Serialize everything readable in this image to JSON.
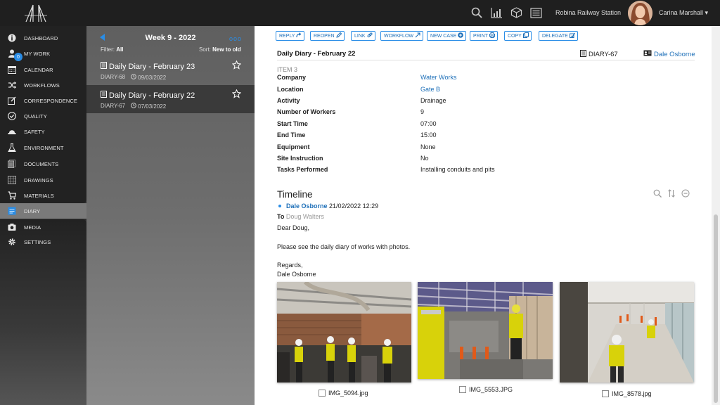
{
  "topbar": {
    "station": "Robina Railway Station",
    "user_name": "Carina Marshall",
    "caret": "▾",
    "icons": [
      "search-icon",
      "chart-icon",
      "box-icon",
      "list-icon"
    ]
  },
  "nav": {
    "badge": "0",
    "items": [
      {
        "label": "DASHBOARD",
        "icon": "info-icon"
      },
      {
        "label": "MY WORK",
        "icon": "person-icon"
      },
      {
        "label": "CALENDAR",
        "icon": "calendar-icon"
      },
      {
        "label": "WORKFLOWS",
        "icon": "shuffle-icon"
      },
      {
        "label": "CORRESPONDENCE",
        "icon": "edit-icon"
      },
      {
        "label": "QUALITY",
        "icon": "check-circle-icon"
      },
      {
        "label": "SAFETY",
        "icon": "hardhat-icon"
      },
      {
        "label": "ENVIRONMENT",
        "icon": "flask-icon"
      },
      {
        "label": "DOCUMENTS",
        "icon": "documents-icon"
      },
      {
        "label": "DRAWINGS",
        "icon": "drawings-icon"
      },
      {
        "label": "MATERIALS",
        "icon": "cart-icon"
      },
      {
        "label": "DIARY",
        "icon": "diary-icon"
      },
      {
        "label": "MEDIA",
        "icon": "camera-icon"
      },
      {
        "label": "SETTINGS",
        "icon": "gear-icon"
      }
    ]
  },
  "list": {
    "week_title": "Week 9 - 2022",
    "dots": "ooo",
    "filter_label": "Filter:",
    "filter_value": "All",
    "sort_label": "Sort:",
    "sort_value": "New to old",
    "items": [
      {
        "title": "Daily Diary - February 23",
        "id": "DIARY-68",
        "date": "09/03/2022"
      },
      {
        "title": "Daily Diary - February 22",
        "id": "DIARY-67",
        "date": "07/03/2022"
      }
    ]
  },
  "toolbar": {
    "buttons": [
      {
        "label": "REPLY",
        "icon": "reply-icon"
      },
      {
        "label": "REOPEN",
        "icon": "pencil-icon"
      },
      {
        "label": "LINK",
        "icon": "link-icon"
      },
      {
        "label": "WORKFLOW",
        "icon": "arrow-out-icon"
      },
      {
        "label": "NEW CASE",
        "icon": "plus-circle-icon"
      },
      {
        "label": "PRINT",
        "icon": "print-icon"
      },
      {
        "label": "COPY",
        "icon": "copy-icon"
      },
      {
        "label": "DELEGATE",
        "icon": "delegate-icon"
      }
    ]
  },
  "entry": {
    "title": "Daily Diary - February 22",
    "id": "DIARY-67",
    "owner": "Dale Osborne",
    "item_label": "ITEM 3",
    "fields": [
      {
        "label": "Company",
        "value": "Water Works",
        "link": true
      },
      {
        "label": "Location",
        "value": "Gate B",
        "link": true
      },
      {
        "label": "Activity",
        "value": "Drainage",
        "link": false
      },
      {
        "label": "Number of Workers",
        "value": "9",
        "link": false
      },
      {
        "label": "Start Time",
        "value": "07:00",
        "link": false
      },
      {
        "label": "End Time",
        "value": "15:00",
        "link": false
      },
      {
        "label": "Equipment",
        "value": "None",
        "link": false
      },
      {
        "label": "Site Instruction",
        "value": "No",
        "link": false
      },
      {
        "label": "Tasks Performed",
        "value": "Installing conduits and pits",
        "link": false
      }
    ]
  },
  "timeline": {
    "title": "Timeline",
    "author": "Dale Osborne",
    "timestamp": "21/02/2022 12:29",
    "to_label": "To",
    "recipient": "Doug Walters",
    "greeting": "Dear Doug,",
    "body": "Please see the daily diary of works with photos.",
    "signoff": "Regards,",
    "signature": "Dale Osborne",
    "photos": [
      {
        "filename": "IMG_5094.jpg"
      },
      {
        "filename": "IMG_5553.JPG"
      },
      {
        "filename": "IMG_8578.jpg"
      }
    ]
  }
}
